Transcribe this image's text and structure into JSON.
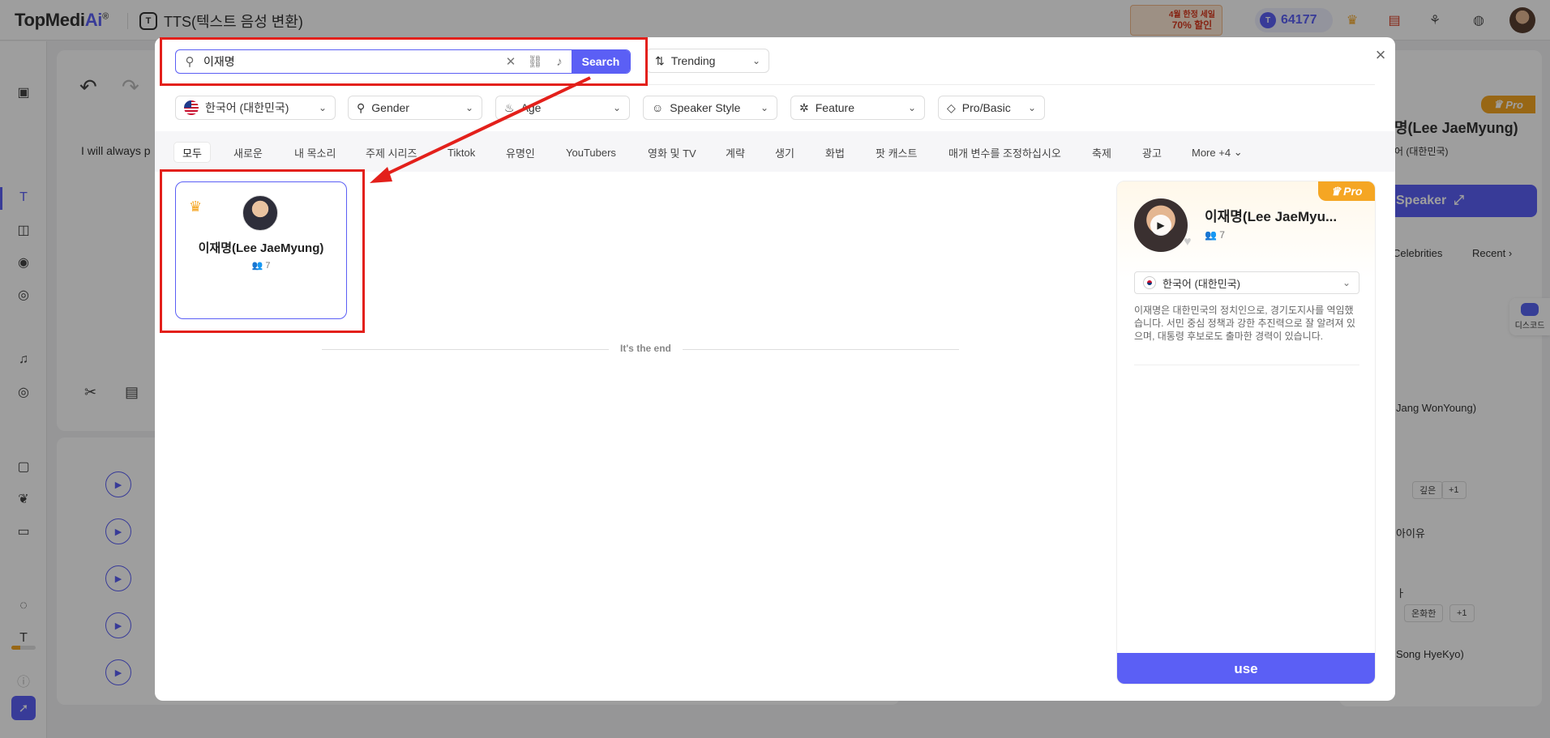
{
  "app": {
    "logo_main": "TopMedi",
    "logo_ai": "Ai",
    "logo_reg": "®",
    "title": "TTS(텍스트 음성 변환)",
    "promo_line1": "4월 한정 세일",
    "promo_line2": "70% 할인",
    "coins": "64177"
  },
  "editor": {
    "sample_text": "I will always p"
  },
  "right_panel": {
    "pro_badge": "Pro",
    "voice_name": "명(Lee JaeMyung)",
    "language": "어 (대한민국)",
    "speaker_button": "Speaker",
    "tab_celebrities": "Celebrities",
    "tab_recent": "Recent",
    "item_1": "Jang WonYoung)",
    "tag_1": "깊은",
    "tag_2": "+1",
    "item_2": "아이유",
    "item_3": "ㅏ",
    "tag_3": "온화한",
    "tag_4": "+1",
    "item_4": "Song HyeKyo)",
    "discord_label": "디스코드"
  },
  "modal": {
    "search": {
      "value": "이재명",
      "button": "Search"
    },
    "sort": "Trending",
    "filters": {
      "language": "한국어 (대한민국)",
      "gender": "Gender",
      "age": "Age",
      "speaker_style": "Speaker Style",
      "feature": "Feature",
      "pro_basic": "Pro/Basic"
    },
    "categories": [
      "모두",
      "새로운",
      "내 목소리",
      "주제 시리즈",
      "Tiktok",
      "유명인",
      "YouTubers",
      "영화 및 TV",
      "계략",
      "생기",
      "화법",
      "팟 캐스트",
      "매개 변수를 조정하십시오",
      "축제",
      "광고",
      "More +4"
    ],
    "card": {
      "name": "이재명(Lee JaeMyung)",
      "users": "7"
    },
    "end_text": "It's the end",
    "detail": {
      "pro_badge": "Pro",
      "name": "이재명(Lee JaeMyu...",
      "users": "7",
      "language": "한국어 (대한민국)",
      "description": "이재명은 대한민국의 정치인으로, 경기도지사를 역임했습니다. 서민 중심 정책과 강한 추진력으로 잘 알려져 있으며, 대통령 후보로도 출마한 경력이 있습니다.",
      "use_button": "use"
    }
  },
  "colors": {
    "accent": "#5b5ff5",
    "pro": "#f5a623",
    "highlight": "#e3201b"
  }
}
